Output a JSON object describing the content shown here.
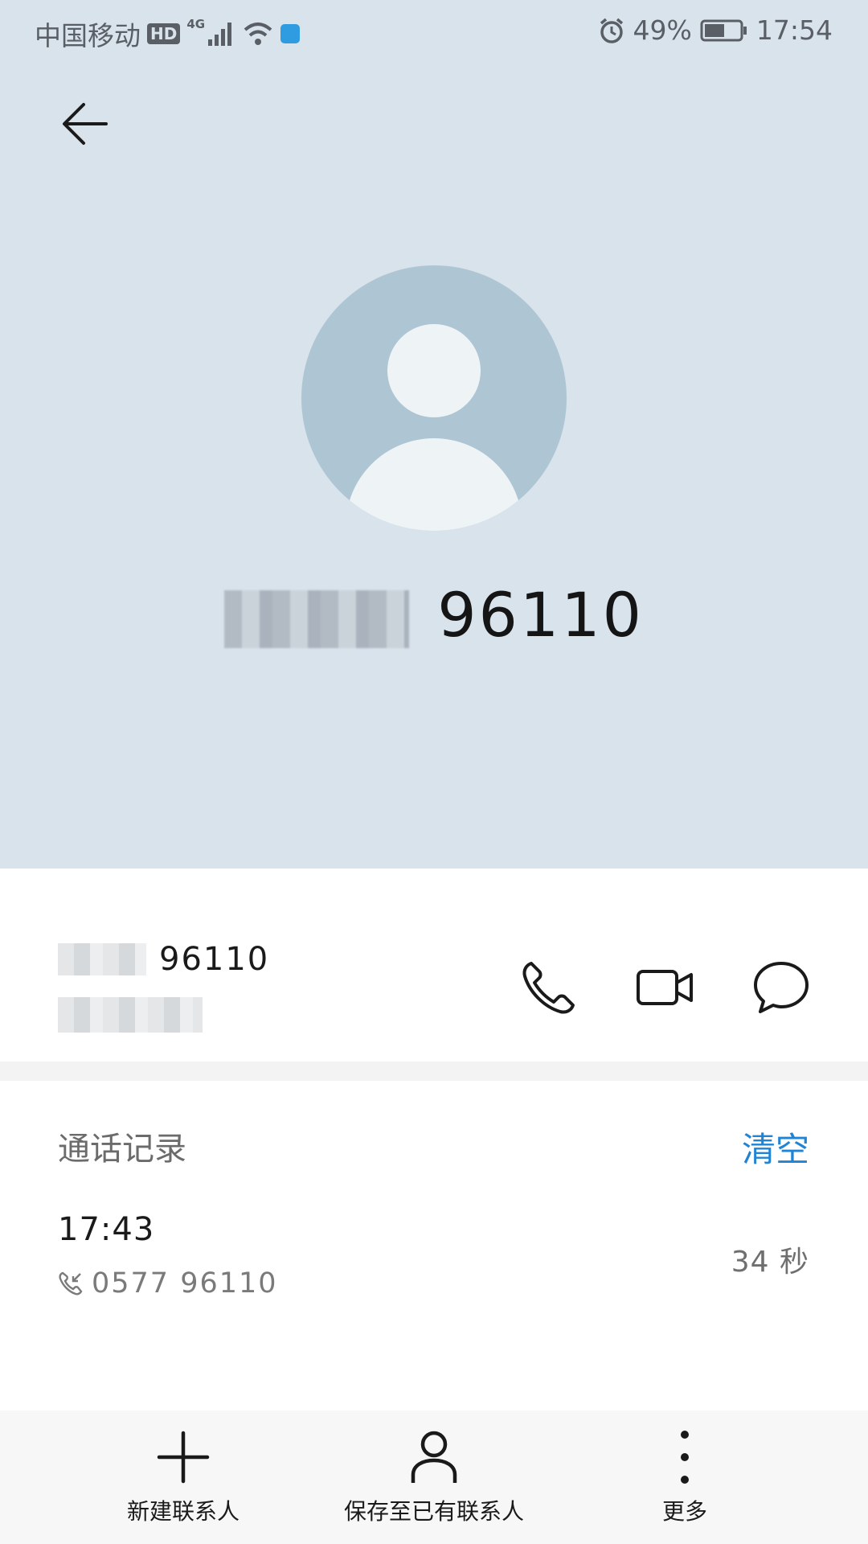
{
  "status_bar": {
    "carrier": "中国移动",
    "hd_badge": "HD",
    "network": "4G",
    "battery_percent": "49%",
    "time": "17:54"
  },
  "header": {
    "display_number": "96110",
    "back_icon": "arrow-left-icon",
    "avatar_icon": "person-icon"
  },
  "contact": {
    "number": "96110",
    "actions": [
      "phone-icon",
      "video-camera-icon",
      "message-bubble-icon"
    ]
  },
  "call_log": {
    "title": "通话记录",
    "clear_label": "清空",
    "entries": [
      {
        "time": "17:43",
        "number": "0577 96110",
        "duration": "34 秒",
        "icon": "incoming-call-icon"
      }
    ]
  },
  "bottom_bar": {
    "items": [
      {
        "label": "新建联系人",
        "icon": "plus-icon"
      },
      {
        "label": "保存至已有联系人",
        "icon": "person-outline-icon"
      },
      {
        "label": "更多",
        "icon": "more-vertical-icon"
      }
    ]
  },
  "colors": {
    "header_bg": "#d9e3ec",
    "avatar_bg": "#aec5d3",
    "accent": "#1f84d6"
  }
}
